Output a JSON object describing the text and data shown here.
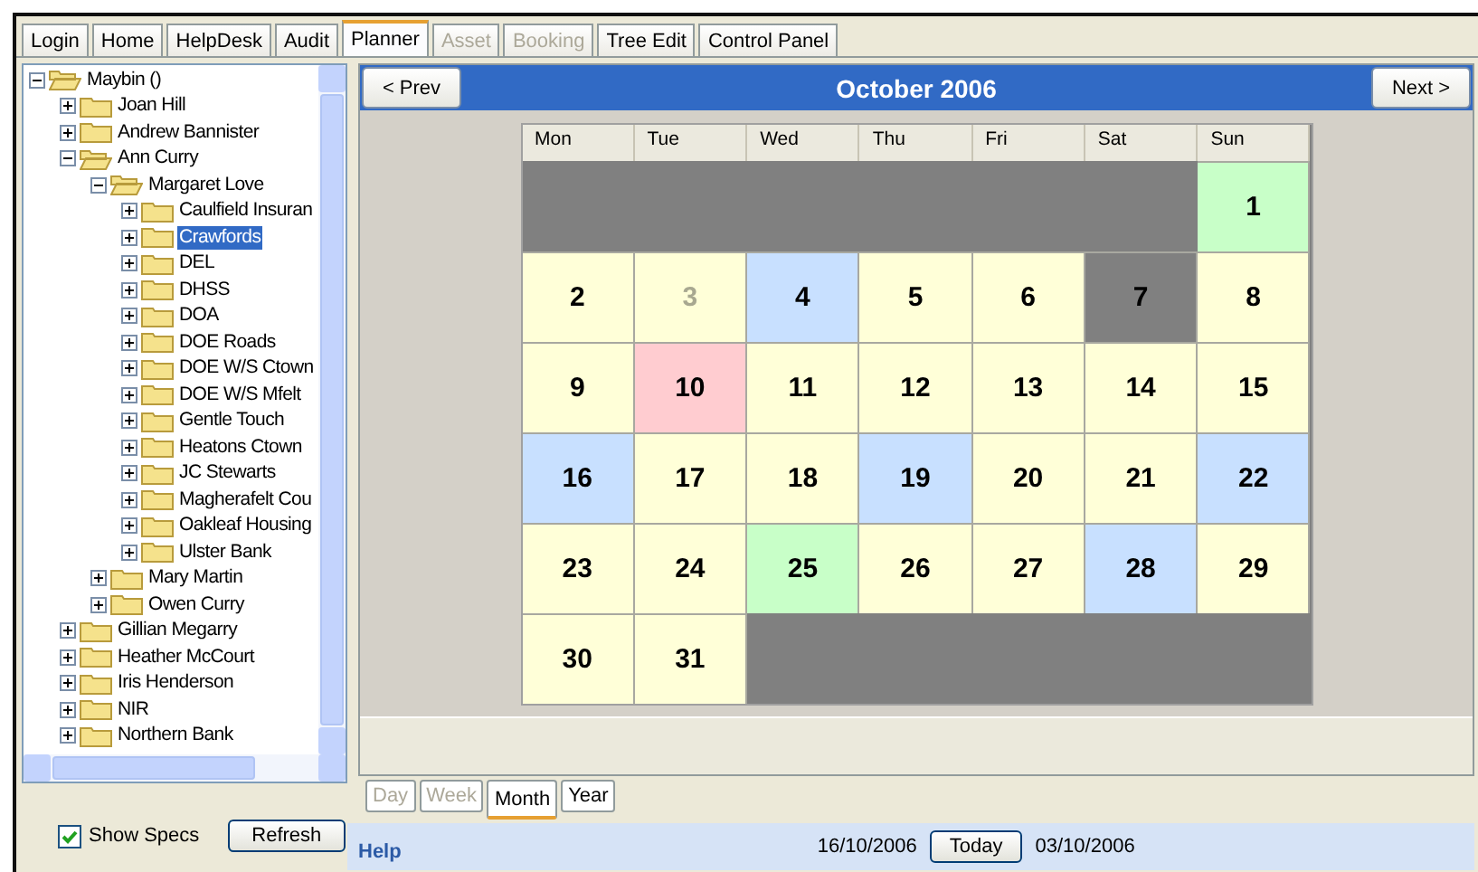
{
  "tabs": [
    {
      "label": "Login",
      "selected": false,
      "disabled": false
    },
    {
      "label": "Home",
      "selected": false,
      "disabled": false
    },
    {
      "label": "HelpDesk",
      "selected": false,
      "disabled": false
    },
    {
      "label": "Audit",
      "selected": false,
      "disabled": false
    },
    {
      "label": "Planner",
      "selected": true,
      "disabled": false
    },
    {
      "label": "Asset",
      "selected": false,
      "disabled": true
    },
    {
      "label": "Booking",
      "selected": false,
      "disabled": true
    },
    {
      "label": "Tree Edit",
      "selected": false,
      "disabled": false
    },
    {
      "label": "Control Panel",
      "selected": false,
      "disabled": false
    }
  ],
  "tree": [
    {
      "label": "Maybin ()",
      "expanded": true,
      "selected": false,
      "children": [
        {
          "label": "Joan Hill",
          "expanded": false,
          "selected": false
        },
        {
          "label": "Andrew Bannister",
          "expanded": false,
          "selected": false
        },
        {
          "label": "Ann Curry",
          "expanded": true,
          "selected": false,
          "children": [
            {
              "label": "Margaret Love",
              "expanded": true,
              "selected": false,
              "children": [
                {
                  "label": "Caulfield Insuran",
                  "expanded": false,
                  "selected": false
                },
                {
                  "label": "Crawfords",
                  "expanded": false,
                  "selected": true
                },
                {
                  "label": "DEL",
                  "expanded": false,
                  "selected": false
                },
                {
                  "label": "DHSS",
                  "expanded": false,
                  "selected": false
                },
                {
                  "label": "DOA",
                  "expanded": false,
                  "selected": false
                },
                {
                  "label": "DOE Roads",
                  "expanded": false,
                  "selected": false
                },
                {
                  "label": "DOE W/S Ctown",
                  "expanded": false,
                  "selected": false
                },
                {
                  "label": "DOE W/S Mfelt",
                  "expanded": false,
                  "selected": false
                },
                {
                  "label": "Gentle Touch",
                  "expanded": false,
                  "selected": false
                },
                {
                  "label": "Heatons Ctown",
                  "expanded": false,
                  "selected": false
                },
                {
                  "label": "JC Stewarts",
                  "expanded": false,
                  "selected": false
                },
                {
                  "label": "Magherafelt Cou",
                  "expanded": false,
                  "selected": false
                },
                {
                  "label": "Oakleaf Housing",
                  "expanded": false,
                  "selected": false
                },
                {
                  "label": "Ulster Bank",
                  "expanded": false,
                  "selected": false
                }
              ]
            },
            {
              "label": "Mary Martin",
              "expanded": false,
              "selected": false
            },
            {
              "label": "Owen Curry",
              "expanded": false,
              "selected": false
            }
          ]
        },
        {
          "label": "Gillian Megarry",
          "expanded": false,
          "selected": false
        },
        {
          "label": "Heather McCourt",
          "expanded": false,
          "selected": false
        },
        {
          "label": "Iris Henderson",
          "expanded": false,
          "selected": false
        },
        {
          "label": "NIR",
          "expanded": false,
          "selected": false
        },
        {
          "label": "Northern Bank",
          "expanded": false,
          "selected": false
        }
      ]
    }
  ],
  "show_specs": {
    "label": "Show Specs",
    "checked": true
  },
  "refresh_button": "Refresh",
  "calendar": {
    "prev_button": "< Prev",
    "title": "October 2006",
    "next_button": "Next >",
    "weekdays": [
      "Mon",
      "Tue",
      "Wed",
      "Thu",
      "Fri",
      "Sat",
      "Sun"
    ],
    "weeks": [
      [
        {
          "kind": "empty"
        },
        {
          "kind": "empty"
        },
        {
          "kind": "empty"
        },
        {
          "kind": "empty"
        },
        {
          "kind": "empty"
        },
        {
          "kind": "empty"
        },
        {
          "kind": "day",
          "day": "1",
          "color": "#c8ffc8",
          "faded": false
        }
      ],
      [
        {
          "kind": "day",
          "day": "2",
          "color": "#ffffd8",
          "faded": false
        },
        {
          "kind": "day",
          "day": "3",
          "color": "#ffffd8",
          "faded": true
        },
        {
          "kind": "day",
          "day": "4",
          "color": "#c8e0ff",
          "faded": false
        },
        {
          "kind": "day",
          "day": "5",
          "color": "#ffffd8",
          "faded": false
        },
        {
          "kind": "day",
          "day": "6",
          "color": "#ffffd8",
          "faded": false
        },
        {
          "kind": "day",
          "day": "7",
          "color": "#808080",
          "faded": false
        },
        {
          "kind": "day",
          "day": "8",
          "color": "#ffffd8",
          "faded": false
        }
      ],
      [
        {
          "kind": "day",
          "day": "9",
          "color": "#ffffd8",
          "faded": false
        },
        {
          "kind": "day",
          "day": "10",
          "color": "#ffccd0",
          "faded": false
        },
        {
          "kind": "day",
          "day": "11",
          "color": "#ffffd8",
          "faded": false
        },
        {
          "kind": "day",
          "day": "12",
          "color": "#ffffd8",
          "faded": false
        },
        {
          "kind": "day",
          "day": "13",
          "color": "#ffffd8",
          "faded": false
        },
        {
          "kind": "day",
          "day": "14",
          "color": "#ffffd8",
          "faded": false
        },
        {
          "kind": "day",
          "day": "15",
          "color": "#ffffd8",
          "faded": false
        }
      ],
      [
        {
          "kind": "day",
          "day": "16",
          "color": "#c8e0ff",
          "faded": false
        },
        {
          "kind": "day",
          "day": "17",
          "color": "#ffffd8",
          "faded": false
        },
        {
          "kind": "day",
          "day": "18",
          "color": "#ffffd8",
          "faded": false
        },
        {
          "kind": "day",
          "day": "19",
          "color": "#c8e0ff",
          "faded": false
        },
        {
          "kind": "day",
          "day": "20",
          "color": "#ffffd8",
          "faded": false
        },
        {
          "kind": "day",
          "day": "21",
          "color": "#ffffd8",
          "faded": false
        },
        {
          "kind": "day",
          "day": "22",
          "color": "#c8e0ff",
          "faded": false
        }
      ],
      [
        {
          "kind": "day",
          "day": "23",
          "color": "#ffffd8",
          "faded": false
        },
        {
          "kind": "day",
          "day": "24",
          "color": "#ffffd8",
          "faded": false
        },
        {
          "kind": "day",
          "day": "25",
          "color": "#c8ffc8",
          "faded": false
        },
        {
          "kind": "day",
          "day": "26",
          "color": "#ffffd8",
          "faded": false
        },
        {
          "kind": "day",
          "day": "27",
          "color": "#ffffd8",
          "faded": false
        },
        {
          "kind": "day",
          "day": "28",
          "color": "#c8e0ff",
          "faded": false
        },
        {
          "kind": "day",
          "day": "29",
          "color": "#ffffd8",
          "faded": false
        }
      ],
      [
        {
          "kind": "day",
          "day": "30",
          "color": "#ffffd8",
          "faded": false
        },
        {
          "kind": "day",
          "day": "31",
          "color": "#ffffd8",
          "faded": false
        },
        {
          "kind": "empty"
        },
        {
          "kind": "empty"
        },
        {
          "kind": "empty"
        },
        {
          "kind": "empty"
        },
        {
          "kind": "empty"
        }
      ]
    ]
  },
  "view_tabs": [
    {
      "label": "Day",
      "selected": false,
      "disabled": true
    },
    {
      "label": "Week",
      "selected": false,
      "disabled": true
    },
    {
      "label": "Month",
      "selected": true,
      "disabled": false
    },
    {
      "label": "Year",
      "selected": false,
      "disabled": false
    }
  ],
  "status_bar": {
    "help_link": "Help",
    "date_left": "16/10/2006",
    "today_button": "Today",
    "date_right": "03/10/2006"
  }
}
